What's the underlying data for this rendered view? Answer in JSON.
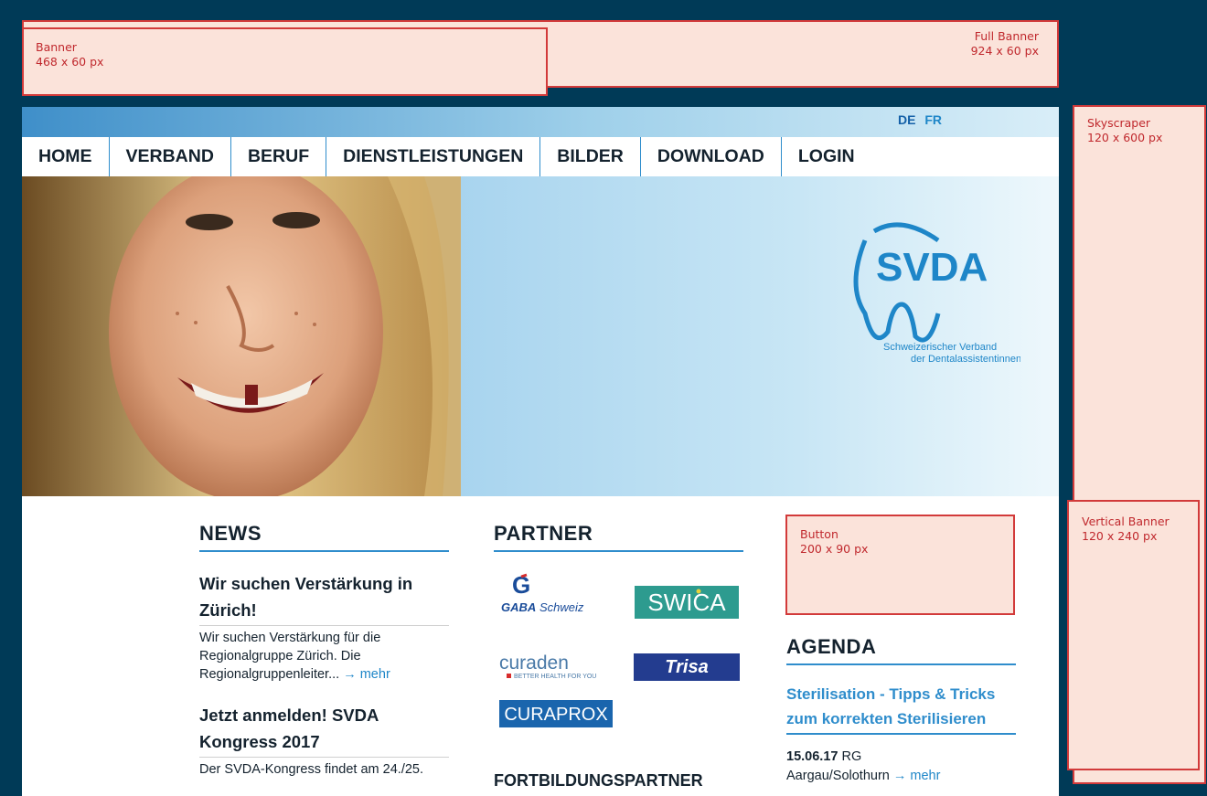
{
  "ads": {
    "full_banner": {
      "title": "Full Banner",
      "size": "924 x 60 px"
    },
    "banner": {
      "title": "Banner",
      "size": "468 x 60 px"
    },
    "skyscraper": {
      "title": "Skyscraper",
      "size": "120 x 600 px"
    },
    "vertical_banner": {
      "title": "Vertical Banner",
      "size": "120 x 240 px"
    },
    "button": {
      "title": "Button",
      "size": "200 x 90 px"
    }
  },
  "lang": {
    "de": "DE",
    "fr": "FR"
  },
  "nav": {
    "home": "HOME",
    "verband": "VERBAND",
    "beruf": "BERUF",
    "dienstleistungen": "DIENSTLEISTUNGEN",
    "bilder": "BILDER",
    "download": "DOWNLOAD",
    "login": "LOGIN"
  },
  "logo": {
    "name": "SVDA",
    "tagline1": "Schweizerischer Verband",
    "tagline2": "der Dentalassistentinnen"
  },
  "news": {
    "heading": "NEWS",
    "items": [
      {
        "title_l1": "Wir suchen Verstärkung in",
        "title_l2": "Zürich!",
        "l1": "Wir suchen Verstärkung für die",
        "l2": "Regionalgruppe Zürich. Die",
        "l3": "Regionalgruppenleiter...",
        "more": "→ mehr"
      },
      {
        "title_l1": "Jetzt anmelden! SVDA",
        "title_l2": "Kongress 2017",
        "l1": "Der SVDA-Kongress findet am 24./25."
      }
    ]
  },
  "partner": {
    "heading": "PARTNER",
    "gaba": "GABA",
    "gaba2": "Schweiz",
    "swica": "SWICA",
    "curaden": "curaden",
    "curaden_tag": "BETTER HEALTH FOR YOU",
    "trisa": "Trisa",
    "curaprox": "CURAPROX"
  },
  "fortbildung": "FORTBILDUNGSPARTNER",
  "agenda": {
    "heading": "AGENDA",
    "event_title_l1": "Sterilisation - Tipps & Tricks",
    "event_title_l2": "zum korrekten Sterilisieren",
    "date": "15.06.17",
    "place1": "RG",
    "place2": "Aargau/Solothurn",
    "more": "→ mehr"
  },
  "colors": {
    "navy": "#003a57",
    "accent": "#2f8dcc",
    "ad_border": "#d23a3a",
    "ad_fill": "#fbe3da"
  }
}
